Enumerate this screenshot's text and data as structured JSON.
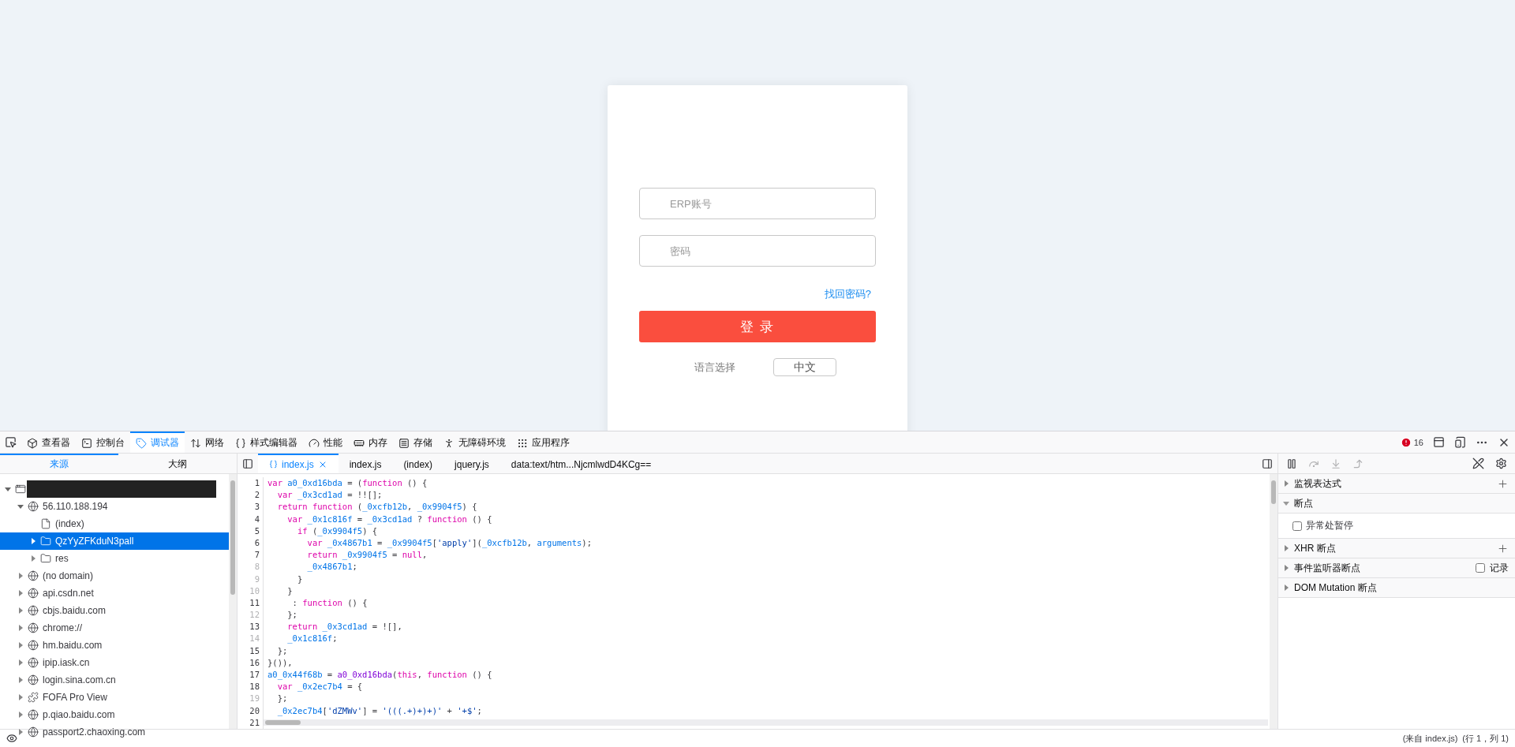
{
  "login": {
    "account": {
      "placeholder": "ERP账号"
    },
    "password": {
      "placeholder": "密码"
    },
    "forgot_link": "找回密码?",
    "submit": "登 录",
    "language_label": "语言选择",
    "language_value": "中文"
  },
  "devtools": {
    "tools": [
      {
        "kind": "inspector",
        "label": "查看器",
        "selected": false
      },
      {
        "kind": "console",
        "label": "控制台",
        "selected": false
      },
      {
        "kind": "debugger",
        "label": "调试器",
        "selected": true
      },
      {
        "kind": "network",
        "label": "网络",
        "selected": false
      },
      {
        "kind": "style",
        "label": "样式编辑器",
        "selected": false
      },
      {
        "kind": "performance",
        "label": "性能",
        "selected": false
      },
      {
        "kind": "memory",
        "label": "内存",
        "selected": false
      },
      {
        "kind": "storage",
        "label": "存储",
        "selected": false
      },
      {
        "kind": "accessibility",
        "label": "无障碍环境",
        "selected": false
      },
      {
        "kind": "application",
        "label": "应用程序",
        "selected": false
      }
    ],
    "error_count": "16",
    "source_tabs": [
      {
        "label": "来源",
        "selected": true
      },
      {
        "label": "大纲",
        "selected": false
      }
    ],
    "tree": [
      {
        "kind": "page",
        "expanded": true,
        "selected": false,
        "children": [
          {
            "kind": "host",
            "label": "56.110.188.194",
            "expanded": true,
            "selected": false,
            "children": [
              {
                "kind": "file",
                "label": "(index)",
                "selected": false
              },
              {
                "kind": "folder",
                "label": "QzYyZFKduN3pall",
                "expanded": false,
                "selected": true
              },
              {
                "kind": "folder",
                "label": "res",
                "expanded": false,
                "selected": false
              }
            ]
          },
          {
            "kind": "host",
            "label": "(no domain)",
            "expanded": false,
            "selected": false
          },
          {
            "kind": "host",
            "label": "api.csdn.net",
            "expanded": false,
            "selected": false
          },
          {
            "kind": "host",
            "label": "cbjs.baidu.com",
            "expanded": false,
            "selected": false
          },
          {
            "kind": "host",
            "label": "chrome://",
            "expanded": false,
            "selected": false
          },
          {
            "kind": "host",
            "label": "hm.baidu.com",
            "expanded": false,
            "selected": false
          },
          {
            "kind": "host",
            "label": "ipip.iask.cn",
            "expanded": false,
            "selected": false
          },
          {
            "kind": "host",
            "label": "login.sina.com.cn",
            "expanded": false,
            "selected": false
          },
          {
            "kind": "extension",
            "label": "FOFA Pro View",
            "expanded": false,
            "selected": false
          },
          {
            "kind": "host",
            "label": "p.qiao.baidu.com",
            "expanded": false,
            "selected": false
          },
          {
            "kind": "host",
            "label": "passport2.chaoxing.com",
            "expanded": false,
            "selected": false
          }
        ]
      }
    ],
    "editor_tabs": [
      {
        "label": "index.js",
        "selected": true,
        "pretty": true
      },
      {
        "label": "index.js",
        "selected": false,
        "pretty": false
      },
      {
        "label": "(index)",
        "selected": false,
        "pretty": false
      },
      {
        "label": "jquery.js",
        "selected": false,
        "pretty": false
      },
      {
        "label": "data:text/htm...NjcmlwdD4KCg==",
        "selected": false,
        "pretty": false
      }
    ],
    "code": [
      {
        "number": "1",
        "breakable": true,
        "tokens": [
          {
            "kind": "kw",
            "text": "var "
          },
          {
            "kind": "id",
            "text": "a0_0xd16bda"
          },
          {
            "kind": "p",
            "text": " = ("
          },
          {
            "kind": "kw",
            "text": "function"
          },
          {
            "kind": "p",
            "text": " () {"
          }
        ]
      },
      {
        "number": "2",
        "breakable": true,
        "tokens": [
          {
            "kind": "kw",
            "text": "  var "
          },
          {
            "kind": "id",
            "text": "_0x3cd1ad"
          },
          {
            "kind": "p",
            "text": " = !![];"
          }
        ]
      },
      {
        "number": "3",
        "breakable": true,
        "tokens": [
          {
            "kind": "kw",
            "text": "  return function"
          },
          {
            "kind": "p",
            "text": " ("
          },
          {
            "kind": "id",
            "text": "_0xcfb12b"
          },
          {
            "kind": "p",
            "text": ", "
          },
          {
            "kind": "id",
            "text": "_0x9904f5"
          },
          {
            "kind": "p",
            "text": ") {"
          }
        ]
      },
      {
        "number": "4",
        "breakable": true,
        "tokens": [
          {
            "kind": "kw",
            "text": "    var "
          },
          {
            "kind": "id",
            "text": "_0x1c816f"
          },
          {
            "kind": "p",
            "text": " = "
          },
          {
            "kind": "id",
            "text": "_0x3cd1ad"
          },
          {
            "kind": "p",
            "text": " ? "
          },
          {
            "kind": "kw",
            "text": "function"
          },
          {
            "kind": "p",
            "text": " () {"
          }
        ]
      },
      {
        "number": "5",
        "breakable": true,
        "tokens": [
          {
            "kind": "kw",
            "text": "      if"
          },
          {
            "kind": "p",
            "text": " ("
          },
          {
            "kind": "id",
            "text": "_0x9904f5"
          },
          {
            "kind": "p",
            "text": ") {"
          }
        ]
      },
      {
        "number": "6",
        "breakable": true,
        "tokens": [
          {
            "kind": "kw",
            "text": "        var "
          },
          {
            "kind": "id",
            "text": "_0x4867b1"
          },
          {
            "kind": "p",
            "text": " = "
          },
          {
            "kind": "id",
            "text": "_0x9904f5"
          },
          {
            "kind": "p",
            "text": "["
          },
          {
            "kind": "str",
            "text": "'apply'"
          },
          {
            "kind": "p",
            "text": "]("
          },
          {
            "kind": "id",
            "text": "_0xcfb12b"
          },
          {
            "kind": "p",
            "text": ", "
          },
          {
            "kind": "id",
            "text": "arguments"
          },
          {
            "kind": "p",
            "text": ");"
          }
        ]
      },
      {
        "number": "7",
        "breakable": true,
        "tokens": [
          {
            "kind": "kw",
            "text": "        return "
          },
          {
            "kind": "id",
            "text": "_0x9904f5"
          },
          {
            "kind": "p",
            "text": " = "
          },
          {
            "kind": "kw",
            "text": "null"
          },
          {
            "kind": "p",
            "text": ","
          }
        ]
      },
      {
        "number": "8",
        "breakable": false,
        "tokens": [
          {
            "kind": "id",
            "text": "        _0x4867b1"
          },
          {
            "kind": "p",
            "text": ";"
          }
        ]
      },
      {
        "number": "9",
        "breakable": false,
        "tokens": [
          {
            "kind": "p",
            "text": "      }"
          }
        ]
      },
      {
        "number": "10",
        "breakable": false,
        "tokens": [
          {
            "kind": "p",
            "text": "    }"
          }
        ]
      },
      {
        "number": "11",
        "breakable": true,
        "tokens": [
          {
            "kind": "p",
            "text": "     : "
          },
          {
            "kind": "kw",
            "text": "function"
          },
          {
            "kind": "p",
            "text": " () {"
          }
        ]
      },
      {
        "number": "12",
        "breakable": false,
        "tokens": [
          {
            "kind": "p",
            "text": "    };"
          }
        ]
      },
      {
        "number": "13",
        "breakable": true,
        "tokens": [
          {
            "kind": "kw",
            "text": "    return "
          },
          {
            "kind": "id",
            "text": "_0x3cd1ad"
          },
          {
            "kind": "p",
            "text": " = ![],"
          }
        ]
      },
      {
        "number": "14",
        "breakable": false,
        "tokens": [
          {
            "kind": "id",
            "text": "    _0x1c816f"
          },
          {
            "kind": "p",
            "text": ";"
          }
        ]
      },
      {
        "number": "15",
        "breakable": true,
        "tokens": [
          {
            "kind": "p",
            "text": "  };"
          }
        ]
      },
      {
        "number": "16",
        "breakable": true,
        "tokens": [
          {
            "kind": "p",
            "text": "}()),"
          }
        ]
      },
      {
        "number": "17",
        "breakable": true,
        "tokens": [
          {
            "kind": "id",
            "text": "a0_0x44f68b"
          },
          {
            "kind": "p",
            "text": " = "
          },
          {
            "kind": "fn",
            "text": "a0_0xd16bda"
          },
          {
            "kind": "p",
            "text": "("
          },
          {
            "kind": "kw",
            "text": "this"
          },
          {
            "kind": "p",
            "text": ", "
          },
          {
            "kind": "kw",
            "text": "function"
          },
          {
            "kind": "p",
            "text": " () {"
          }
        ]
      },
      {
        "number": "18",
        "breakable": true,
        "tokens": [
          {
            "kind": "kw",
            "text": "  var "
          },
          {
            "kind": "id",
            "text": "_0x2ec7b4"
          },
          {
            "kind": "p",
            "text": " = {"
          }
        ]
      },
      {
        "number": "19",
        "breakable": false,
        "tokens": [
          {
            "kind": "p",
            "text": "  };"
          }
        ]
      },
      {
        "number": "20",
        "breakable": true,
        "tokens": [
          {
            "kind": "id",
            "text": "  _0x2ec7b4"
          },
          {
            "kind": "p",
            "text": "["
          },
          {
            "kind": "str",
            "text": "'dZMWv'"
          },
          {
            "kind": "p",
            "text": "] = "
          },
          {
            "kind": "str",
            "text": "'(((.+)+)+)'"
          },
          {
            "kind": "p",
            "text": " + "
          },
          {
            "kind": "str",
            "text": "'+$'"
          },
          {
            "kind": "p",
            "text": ";"
          }
        ]
      },
      {
        "number": "21",
        "breakable": true
      }
    ],
    "panes": [
      {
        "label": "监视表达式",
        "expanded": false,
        "kind": "add"
      },
      {
        "label": "断点",
        "expanded": true,
        "kind": "plain",
        "options": [
          {
            "label": "异常处暂停",
            "checked": false
          }
        ]
      },
      {
        "label": "XHR 断点",
        "expanded": false,
        "kind": "add"
      },
      {
        "label": "事件监听器断点",
        "expanded": false,
        "kind": "log",
        "action_label": "记录",
        "checked": false
      },
      {
        "label": "DOM Mutation 断点",
        "expanded": false,
        "kind": "plain"
      }
    ],
    "status": {
      "source": "(来自 index.js)",
      "position": "(行 1，列 1)"
    }
  }
}
